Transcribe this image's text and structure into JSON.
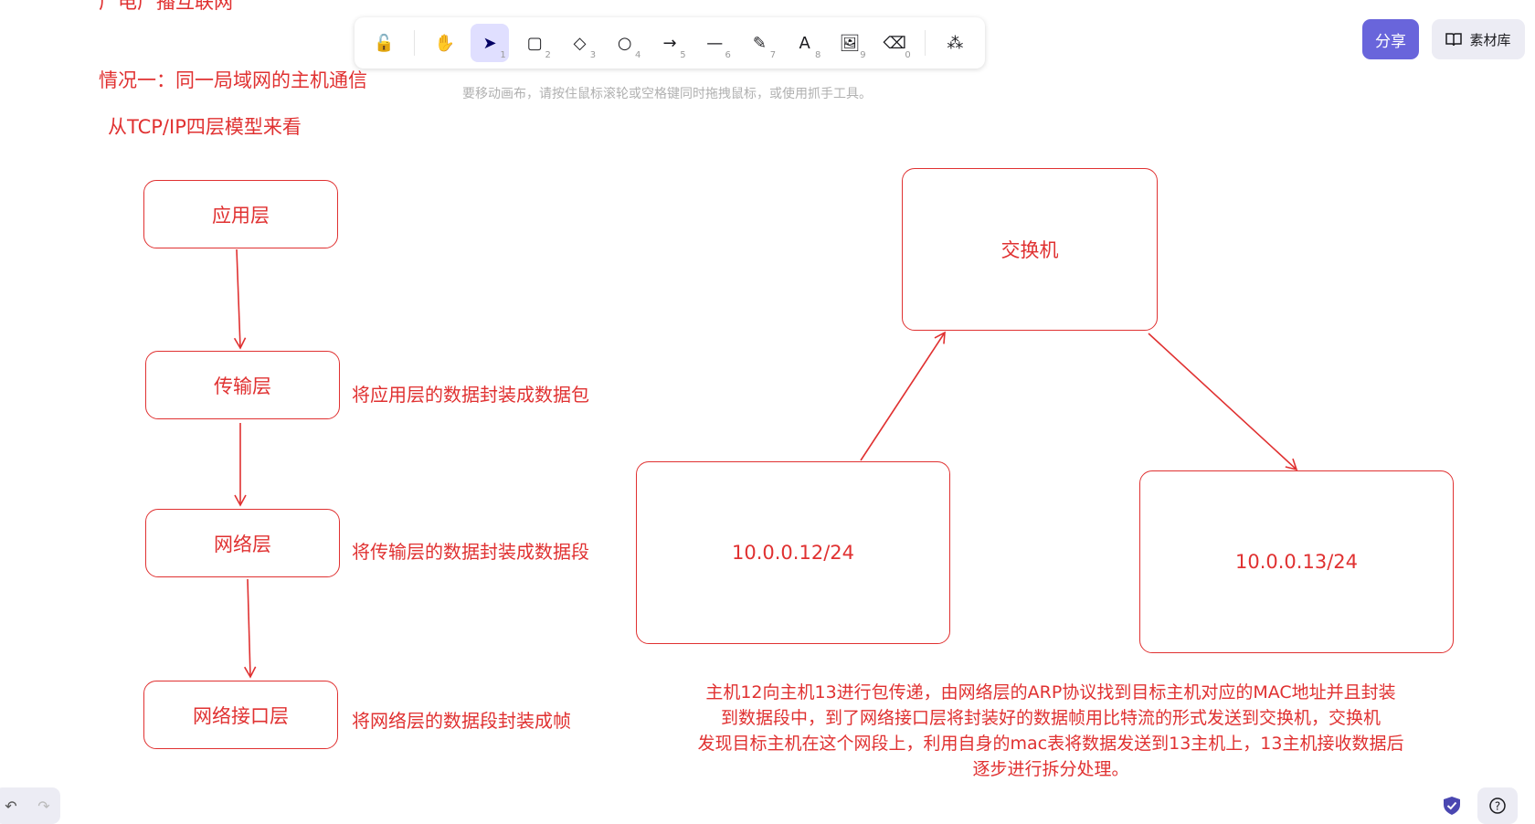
{
  "canvas": {
    "heading_cut": "广电广播互联网",
    "case_title": "情况一：同一局域网的主机通信",
    "model_title": "从TCP/IP四层模型来看",
    "layers": [
      "应用层",
      "传输层",
      "网络层",
      "网络接口层"
    ],
    "layer_notes": [
      "将应用层的数据封装成数据包",
      "将传输层的数据封装成数据段",
      "将网络层的数据段封装成帧"
    ],
    "switch_label": "交换机",
    "host_a": "10.0.0.12/24",
    "host_b": "10.0.0.13/24",
    "description": [
      "主机12向主机13进行包传递，由网络层的ARP协议找到目标主机对应的MAC地址并且封装",
      "到数据段中，到了网络接口层将封装好的数据帧用比特流的形式发送到交换机，交换机",
      "发现目标主机在这个网段上，利用自身的mac表将数据发送到13主机上，13主机接收数据后",
      "逐步进行拆分处理。"
    ],
    "stroke_color": "#e03131"
  },
  "toolbar": {
    "tools": [
      {
        "name": "lock",
        "icon": "lock-icon",
        "glyph": "🔓",
        "key": ""
      },
      {
        "name": "hand",
        "icon": "hand-icon",
        "glyph": "✋",
        "key": ""
      },
      {
        "name": "selection",
        "icon": "cursor-icon",
        "glyph": "➤",
        "key": "1"
      },
      {
        "name": "rectangle",
        "icon": "rectangle-icon",
        "glyph": "▢",
        "key": "2"
      },
      {
        "name": "diamond",
        "icon": "diamond-icon",
        "glyph": "◇",
        "key": "3"
      },
      {
        "name": "ellipse",
        "icon": "ellipse-icon",
        "glyph": "○",
        "key": "4"
      },
      {
        "name": "arrow",
        "icon": "arrow-icon",
        "glyph": "→",
        "key": "5"
      },
      {
        "name": "line",
        "icon": "line-icon",
        "glyph": "—",
        "key": "6"
      },
      {
        "name": "draw",
        "icon": "pencil-icon",
        "glyph": "✎",
        "key": "7"
      },
      {
        "name": "text",
        "icon": "text-icon",
        "glyph": "A",
        "key": "8"
      },
      {
        "name": "image",
        "icon": "image-icon",
        "glyph": "🖼",
        "key": "9"
      },
      {
        "name": "eraser",
        "icon": "eraser-icon",
        "glyph": "⌫",
        "key": "0"
      },
      {
        "name": "more",
        "icon": "shapes-icon",
        "glyph": "⁂",
        "key": ""
      }
    ],
    "active": "selection",
    "accent": "#6965db",
    "active_bg": "#e0dfff"
  },
  "hint": "要移动画布，请按住鼠标滚轮或空格键同时拖拽鼠标，或使用抓手工具。",
  "header": {
    "share_label": "分享",
    "library_label": "素材库"
  },
  "footer": {
    "undo_glyph": "↶",
    "redo_glyph": "↷",
    "help_glyph": "?"
  }
}
